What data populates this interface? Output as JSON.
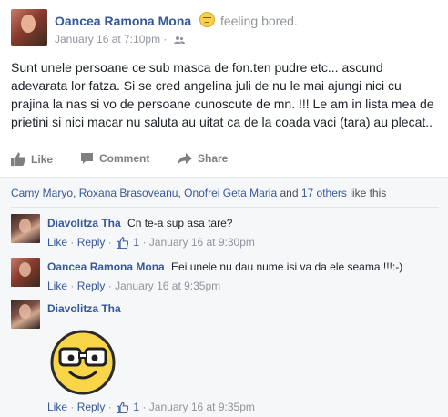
{
  "post": {
    "author": "Oancea Ramona Mona",
    "feeling": "feeling bored.",
    "timestamp": "January 16 at 7:10pm",
    "separator": "·",
    "text": "Sunt unele persoane ce sub masca de fon.ten pudre etc... ascund adevarata lor fatza. Si se cred angelina juli de nu le mai ajungi nici cu prajina la nas si vo de persoane cunoscute de mn. !!! Le am in lista mea de prietini si nici macar nu saluta au uitat ca de la coada vaci (tara) au plecat.."
  },
  "actions": {
    "like": "Like",
    "comment": "Comment",
    "share": "Share"
  },
  "likes": {
    "name1": "Camy Maryo",
    "sep1": ", ",
    "name2": "Roxana Brasoveanu",
    "sep2": ", ",
    "name3": "Onofrei Geta Maria",
    "and": " and ",
    "others": "17 others",
    "suffix": " like this"
  },
  "comments": [
    {
      "author": "Diavolitza Tha",
      "text": "Cn te-a sup asa tare?",
      "like": "Like",
      "reply": "Reply",
      "likes_count": "1",
      "timestamp": "January 16 at 9:30pm"
    },
    {
      "author": "Oancea Ramona Mona",
      "text": "Eei unele nu dau nume isi va da ele seama !!!:-)",
      "like": "Like",
      "reply": "Reply",
      "timestamp": "January 16 at 9:35pm"
    },
    {
      "author": "Diavolitza Tha",
      "sticker": "nerd-smiley-sticker",
      "like": "Like",
      "reply": "Reply",
      "likes_count": "1",
      "timestamp": "January 16 at 9:35pm"
    }
  ],
  "meta_separator": "·",
  "colors": {
    "link": "#365899",
    "muted": "#90949c",
    "text": "#1d2129",
    "feedback_bg": "#f6f7f9"
  }
}
